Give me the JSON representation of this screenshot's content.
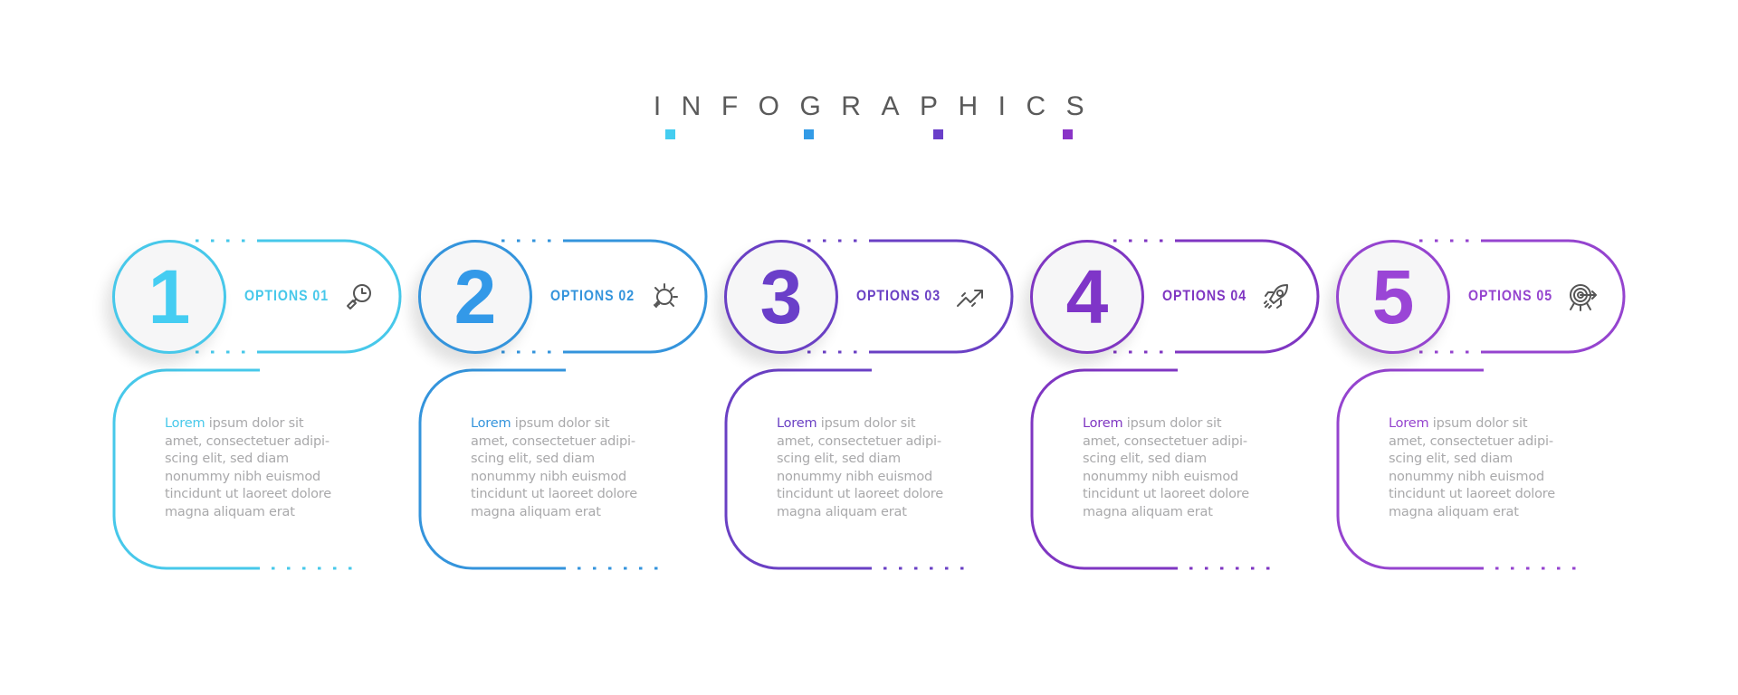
{
  "title": "INFOGRAPHICS",
  "title_squares": [
    "#44cdf0",
    "#339be6",
    "#6a3fc9",
    "#8a34c7"
  ],
  "steps": [
    {
      "number": "1",
      "label": "OPTIONS 01",
      "icon": "search-clock-icon",
      "color": "#47c8ea",
      "number_color": "#45cdf2",
      "lead": "Lorem",
      "lines": [
        "ipsum dolor sit",
        "amet, consectetuer adipi-",
        "scing elit, sed diam",
        "nonummy nibh euismod",
        "tincidunt ut laoreet dolore",
        "magna aliquam erat"
      ]
    },
    {
      "number": "2",
      "label": "OPTIONS 02",
      "icon": "lightbulb-icon",
      "color": "#3494dc",
      "number_color": "#3399e8",
      "lead": "Lorem",
      "lines": [
        "ipsum dolor sit",
        "amet, consectetuer adipi-",
        "scing elit, sed diam",
        "nonummy nibh euismod",
        "tincidunt ut laoreet dolore",
        "magna aliquam erat"
      ]
    },
    {
      "number": "3",
      "label": "OPTIONS 03",
      "icon": "trending-up-icon",
      "color": "#6a40c4",
      "number_color": "#6a3fc9",
      "lead": "Lorem",
      "lines": [
        "ipsum dolor sit",
        "amet, consectetuer adipi-",
        "scing elit, sed diam",
        "nonummy nibh euismod",
        "tincidunt ut laoreet dolore",
        "magna aliquam erat"
      ]
    },
    {
      "number": "4",
      "label": "OPTIONS 04",
      "icon": "rocket-icon",
      "color": "#7f36c2",
      "number_color": "#7f35c8",
      "lead": "Lorem",
      "lines": [
        "ipsum dolor sit",
        "amet, consectetuer adipi-",
        "scing elit, sed diam",
        "nonummy nibh euismod",
        "tincidunt ut laoreet dolore",
        "magna aliquam erat"
      ]
    },
    {
      "number": "5",
      "label": "OPTIONS 05",
      "icon": "target-icon",
      "color": "#9544cf",
      "number_color": "#9a45d6",
      "lead": "Lorem",
      "lines": [
        "ipsum dolor sit",
        "amet, consectetuer adipi-",
        "scing elit, sed diam",
        "nonummy nibh euismod",
        "tincidunt ut laoreet dolore",
        "magna aliquam erat"
      ]
    }
  ]
}
